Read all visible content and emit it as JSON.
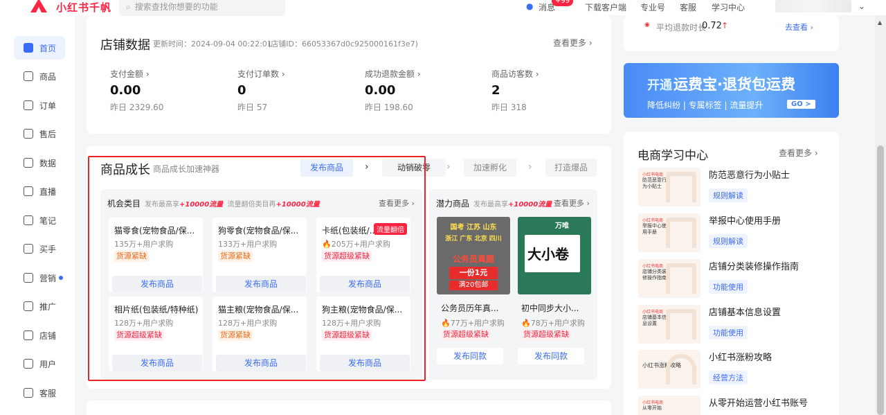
{
  "app": {
    "name": "小红书千帆"
  },
  "search": {
    "placeholder": "搜索查找你想要的功能"
  },
  "topnav": {
    "messages": "消息",
    "badge": "+99",
    "download": "下载客户端",
    "pro": "专业号",
    "service": "客服",
    "learning": "学习中心"
  },
  "sidebar": {
    "items": [
      {
        "label": "首页"
      },
      {
        "label": "商品"
      },
      {
        "label": "订单"
      },
      {
        "label": "售后"
      },
      {
        "label": "数据"
      },
      {
        "label": "直播"
      },
      {
        "label": "笔记"
      },
      {
        "label": "买手"
      },
      {
        "label": "营销"
      },
      {
        "label": "推广"
      },
      {
        "label": "店铺"
      },
      {
        "label": "用户"
      },
      {
        "label": "客服"
      }
    ]
  },
  "store_data": {
    "title": "店铺数据",
    "updated": "更新时间：2024-09-04 00:22:01",
    "store_id": "(店铺ID：66053367d0c925000161f3e7)",
    "more": "查看更多",
    "metrics": [
      {
        "label": "支付金额",
        "value": "0.00",
        "yesterday": "昨日 2329.60"
      },
      {
        "label": "支付订单数",
        "value": "0",
        "yesterday": "昨日 57"
      },
      {
        "label": "成功退款金额",
        "value": "0.00",
        "yesterday": "昨日 198.60"
      },
      {
        "label": "商品访客数",
        "value": "2",
        "yesterday": "昨日 318"
      }
    ]
  },
  "growth": {
    "title": "商品成长",
    "subtitle": "商品成长加速神器",
    "steps": [
      "发布商品",
      "动销破零",
      "加速孵化",
      "打造爆品"
    ],
    "opportunity": {
      "title": "机会类目",
      "hint1": "发布最高享",
      "hint1_em": "+10000流量",
      "hint2": "流量翻倍类目再",
      "hint2_em": "+10000流量",
      "more": "查看更多",
      "cells": [
        {
          "title": "猫零食(宠物食品/保...",
          "demand": "135万+用户求购",
          "tag": "货源紧缺",
          "button": "发布商品"
        },
        {
          "title": "狗零食(宠物食品/保...",
          "demand": "133万+用户求购",
          "tag": "货源紧缺",
          "button": "发布商品"
        },
        {
          "title": "卡纸(包装纸/...",
          "demand": "205万+用户求购",
          "tag": "货源超级紧缺",
          "hot": "流量翻倍",
          "button": "发布商品"
        },
        {
          "title": "相片纸(包装纸/特种纸)",
          "demand": "128万+用户求购",
          "tag": "货源超级紧缺",
          "button": "发布商品"
        },
        {
          "title": "猫主粮(宠物食品/保...",
          "demand": "128万+用户求购",
          "tag": "货源紧缺",
          "button": "发布商品"
        },
        {
          "title": "狗主粮(宠物食品/保...",
          "demand": "128万+用户求购",
          "tag": "货源超级紧缺",
          "button": "发布商品"
        }
      ]
    },
    "potential": {
      "title": "潜力商品",
      "hint": "发布最高享",
      "hint_em": "+10000流量",
      "more": "查看更多",
      "items": [
        {
          "title": "公务员历年真...",
          "demand": "77万+用户求购",
          "tag": "货源超级紧缺",
          "button": "发布同款",
          "img_line1": "国考 江苏 山东",
          "img_line2": "浙江 广东 北京 四川",
          "img_line3": "公务员真题",
          "img_line4": "一份1元",
          "img_line5": "满20包邮"
        },
        {
          "title": "初中同步大小...",
          "demand": "78万+用户求购",
          "tag": "货源超级紧缺",
          "button": "发布同款",
          "img_line1": "万唯",
          "img_line2": "大小卷"
        }
      ]
    }
  },
  "refund": {
    "label": "平均退款时长",
    "value": "0.72",
    "link": "去查看"
  },
  "banner": {
    "title_a": "开通",
    "title_b": "运费宝·退货包运费",
    "subtitle": "降低纠纷 | 专属标签 | 流量提升",
    "go": "GO >"
  },
  "learning": {
    "title": "电商学习中心",
    "more": "查看更多",
    "items": [
      {
        "title": "防范恶意行为小贴士",
        "tag": "规则解读",
        "thumb": "防范恶意行为小贴士"
      },
      {
        "title": "举报中心使用手册",
        "tag": "规则解读",
        "thumb": "举报中心使用手册"
      },
      {
        "title": "店铺分类装修操作指南",
        "tag": "功能使用",
        "thumb": "店铺分类装修操作指南"
      },
      {
        "title": "店铺基本信息设置",
        "tag": "功能使用",
        "thumb": "店铺基本信息设置"
      },
      {
        "title": "小红书涨粉攻略",
        "tag": "经营方法",
        "thumb": "小红书涨粉攻略"
      },
      {
        "title": "从零开始运营小红书账号",
        "tag": "",
        "thumb": "从零开始"
      }
    ],
    "brand": "小红书电商"
  }
}
